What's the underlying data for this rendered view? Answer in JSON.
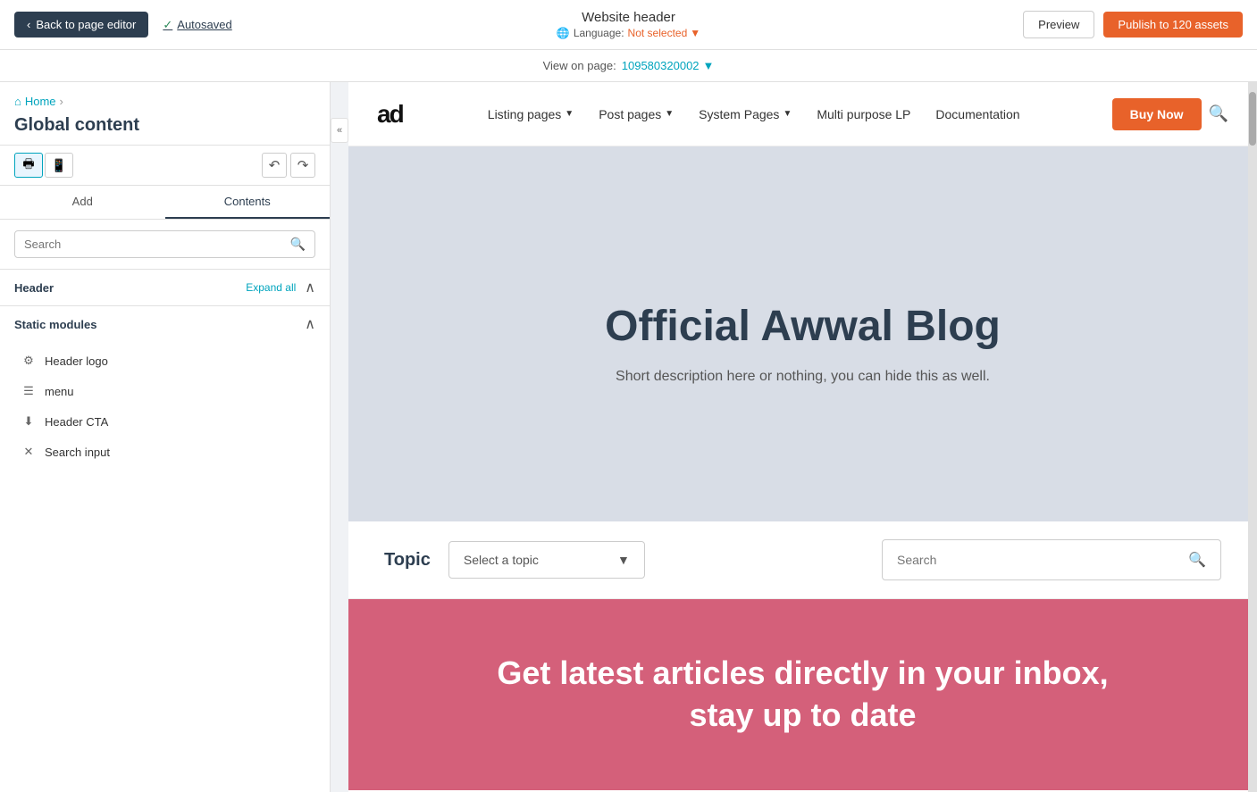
{
  "topbar": {
    "back_label": "Back to page editor",
    "autosaved_label": "Autosaved",
    "title": "Website header",
    "language_label": "Language:",
    "language_value": "Not selected",
    "view_on_page_label": "View on page:",
    "page_id": "109580320002",
    "preview_label": "Preview",
    "publish_label": "Publish to 120 assets"
  },
  "sidebar": {
    "breadcrumb": "Home",
    "page_title": "Global content",
    "tab_add": "Add",
    "tab_contents": "Contents",
    "search_placeholder": "Search",
    "header_section_label": "Header",
    "expand_all_label": "Expand all",
    "static_modules_label": "Static modules",
    "modules": [
      {
        "icon": "image-icon",
        "label": "Header logo"
      },
      {
        "icon": "menu-icon",
        "label": "menu"
      },
      {
        "icon": "download-icon",
        "label": "Header CTA"
      },
      {
        "icon": "x-icon",
        "label": "Search input"
      }
    ]
  },
  "preview": {
    "nav": {
      "logo": "ad",
      "menu_items": [
        {
          "label": "Listing pages",
          "has_chevron": true
        },
        {
          "label": "Post pages",
          "has_chevron": true
        },
        {
          "label": "System Pages",
          "has_chevron": true
        },
        {
          "label": "Multi purpose LP",
          "has_chevron": false
        },
        {
          "label": "Documentation",
          "has_chevron": false
        }
      ],
      "buy_btn": "Buy Now"
    },
    "hero": {
      "title": "Official Awwal Blog",
      "description": "Short description here or nothing, you can hide this as well."
    },
    "filter": {
      "topic_label": "Topic",
      "select_placeholder": "Select a topic",
      "search_placeholder": "Search"
    },
    "cta": {
      "title": "Get latest articles directly in your inbox, stay up to date"
    }
  }
}
